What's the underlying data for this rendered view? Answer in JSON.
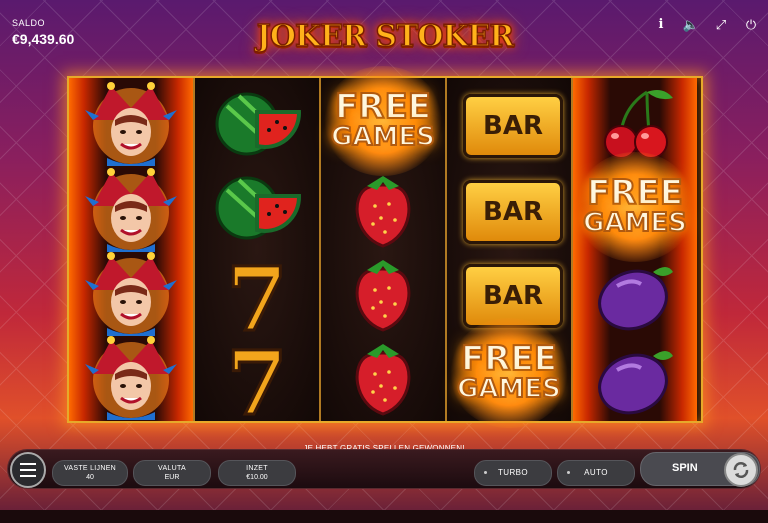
{
  "header": {
    "balance_label": "SALDO",
    "balance_value": "€9,439.60",
    "logo_text": "JOKER STOKER",
    "icons": [
      "info-icon",
      "sound-icon",
      "fullscreen-icon",
      "power-icon"
    ],
    "info_glyph": "i",
    "sound_glyph": "🔈",
    "fullscreen_glyph": "⤢",
    "power_glyph": "⏻"
  },
  "reels": [
    {
      "symbols": [
        "joker",
        "joker",
        "joker",
        "joker"
      ]
    },
    {
      "symbols": [
        "watermelon",
        "watermelon",
        "seven",
        "seven"
      ]
    },
    {
      "symbols": [
        "free-games",
        "strawberry",
        "strawberry",
        "strawberry"
      ]
    },
    {
      "symbols": [
        "bar",
        "bar",
        "bar",
        "free-games"
      ]
    },
    {
      "symbols": [
        "cherry",
        "free-games",
        "plum",
        "plum"
      ]
    }
  ],
  "symbols": {
    "bar_text": "BAR",
    "free_line1": "FREE",
    "free_line2": "GAMES",
    "seven_text": "7"
  },
  "message": "JE HEBT GRATIS SPELLEN GEWONNEN!",
  "controls": {
    "lines_label": "VASTE LIJNEN",
    "lines_value": "40",
    "currency_label": "VALUTA",
    "currency_value": "EUR",
    "bet_label": "INZET",
    "bet_value": "€10.00",
    "turbo_label": "TURBO",
    "auto_label": "AUTO",
    "spin_label": "SPIN"
  },
  "colors": {
    "frame_gold": "#e7a92a",
    "bar_gold": "#ffcf43",
    "free_glow": "#ff7a00"
  }
}
